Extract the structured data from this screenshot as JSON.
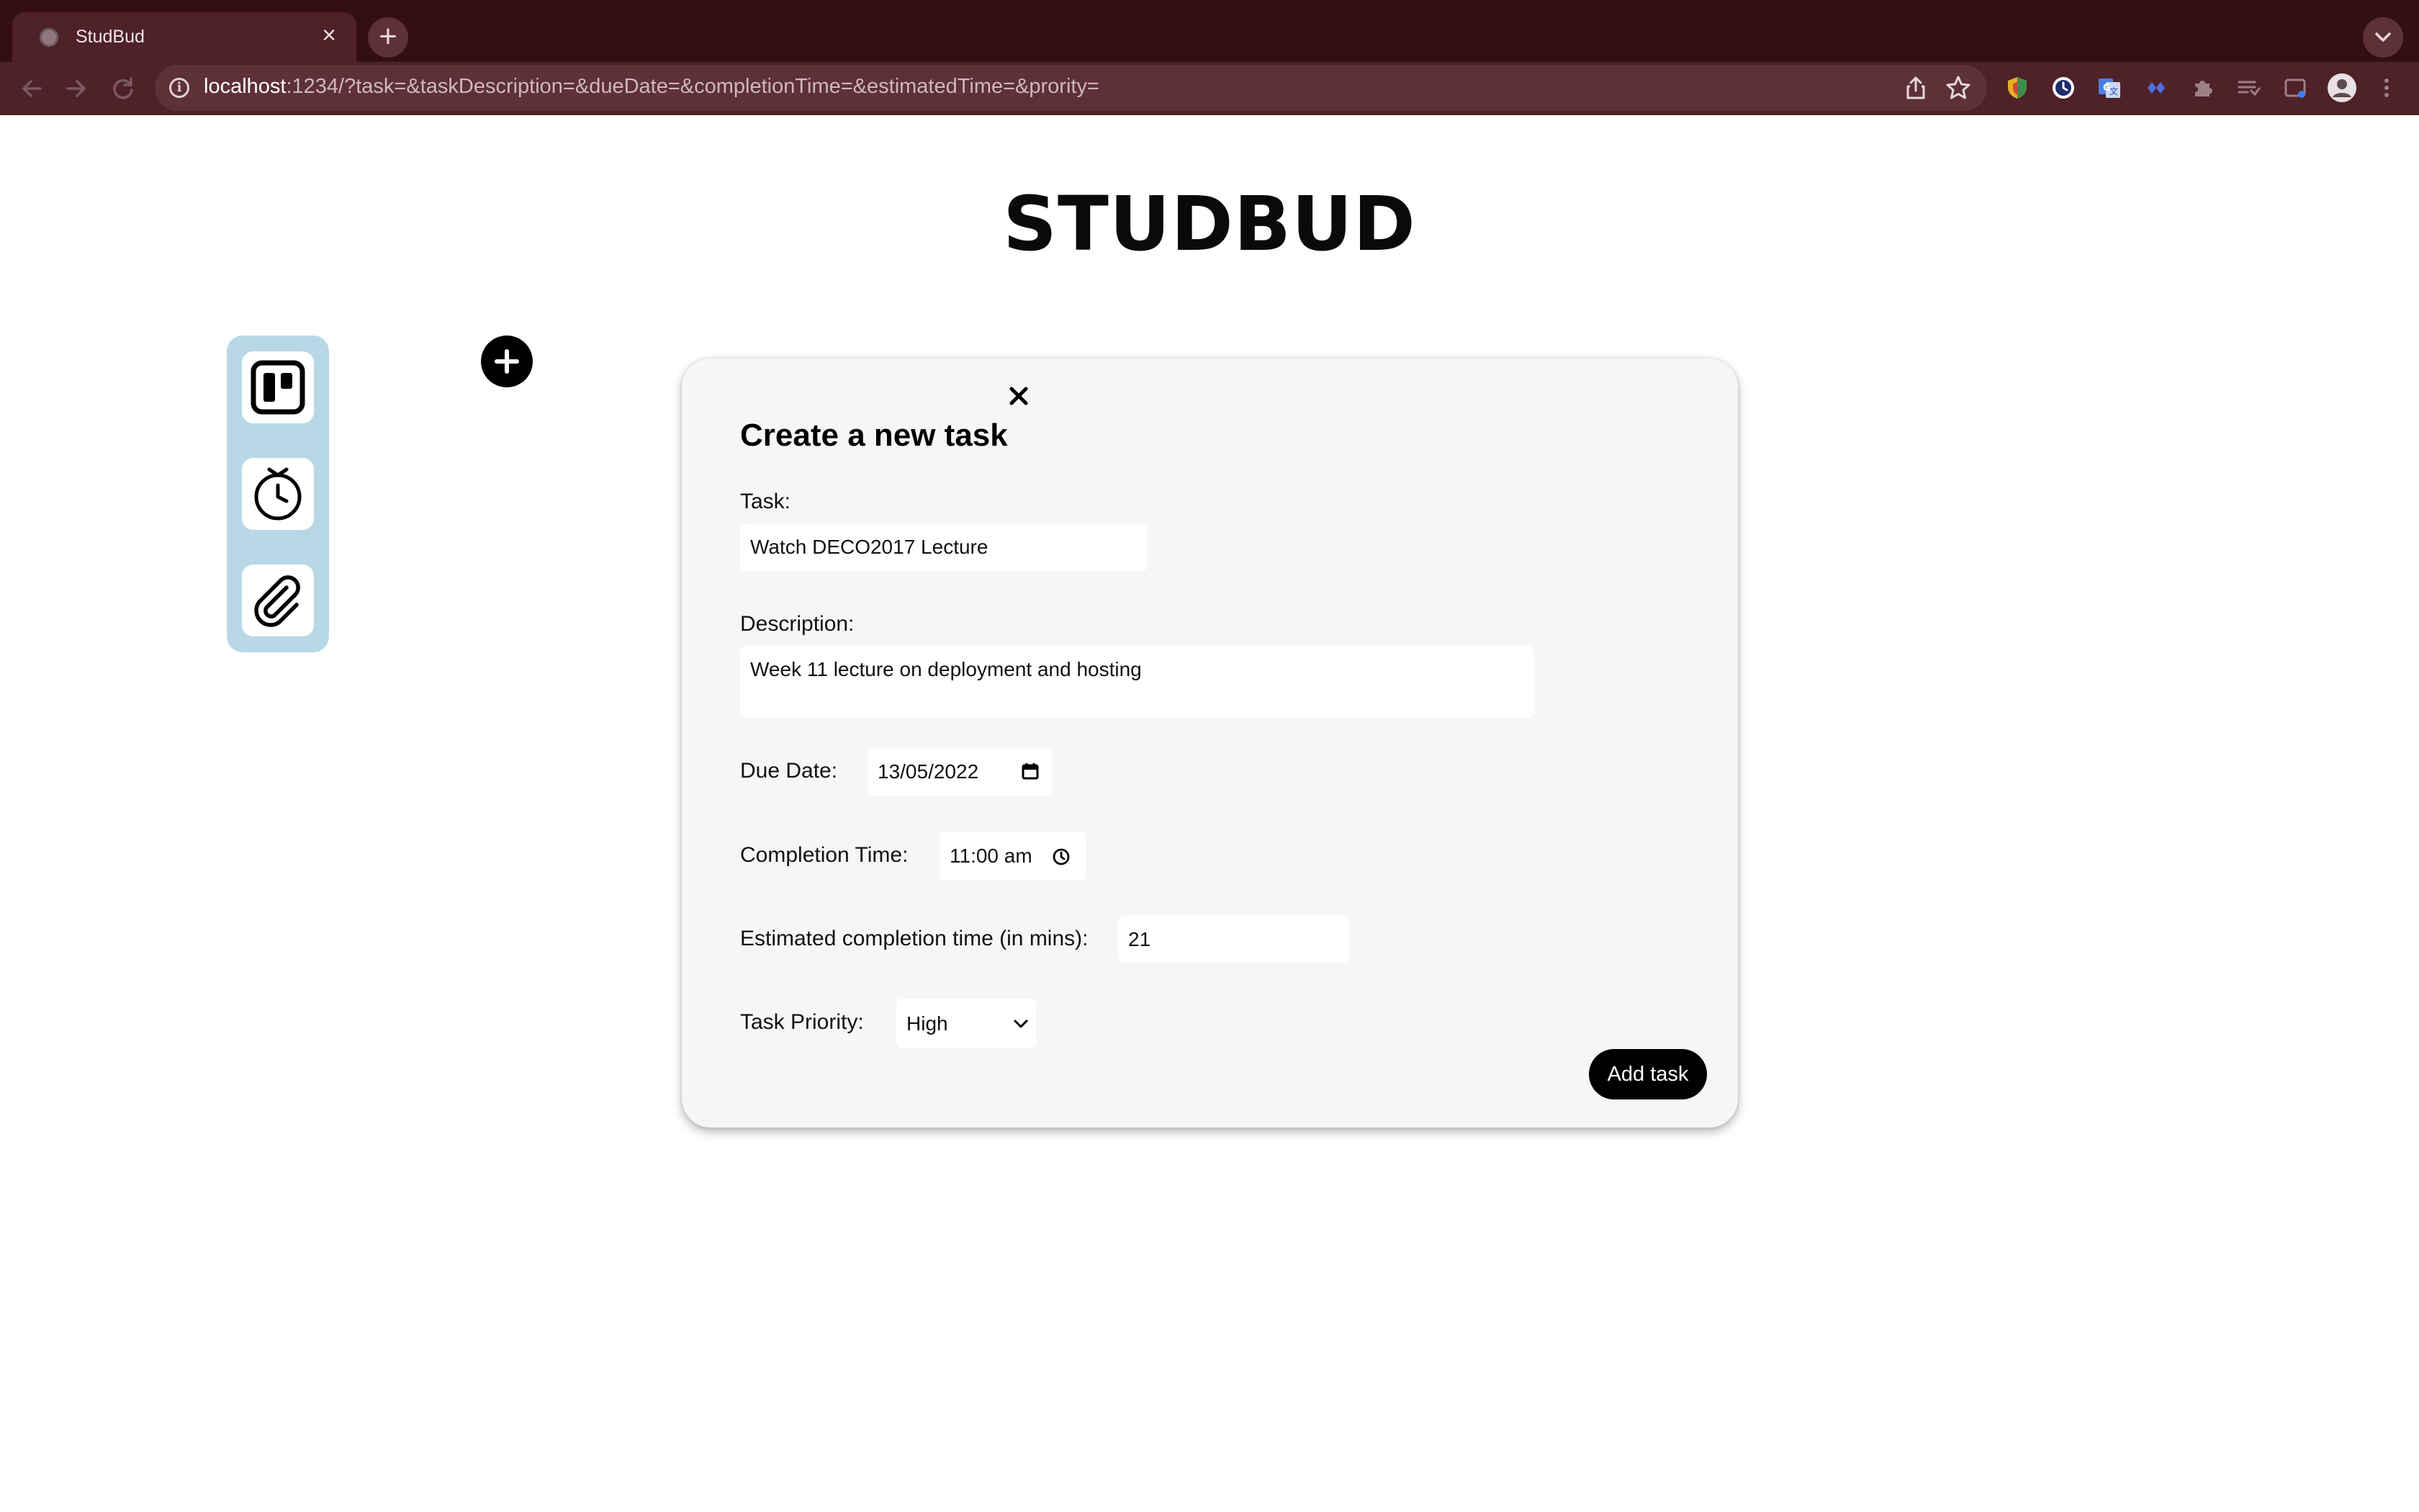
{
  "browser": {
    "tab_title": "StudBud",
    "url_host": "localhost",
    "url_rest": ":1234/?task=&taskDescription=&dueDate=&completionTime=&estimatedTime=&prority="
  },
  "page": {
    "title": "STUDBUD"
  },
  "sidebar": {
    "items": [
      {
        "icon": "board-icon"
      },
      {
        "icon": "stopwatch-icon"
      },
      {
        "icon": "paperclip-icon"
      }
    ]
  },
  "modal": {
    "heading": "Create a new task",
    "task_label": "Task:",
    "task_value": "Watch DECO2017 Lecture",
    "description_label": "Description:",
    "description_value": "Week 11 lecture on deployment and hosting",
    "due_date_label": "Due Date:",
    "due_date_value": "13/05/2022",
    "completion_time_label": "Completion Time:",
    "completion_time_value": "11:00 am",
    "estimated_label": "Estimated completion time (in mins):",
    "estimated_value": "21",
    "priority_label": "Task Priority:",
    "priority_value": "High",
    "submit_label": "Add task"
  },
  "colors": {
    "tabstrip": "#330f12",
    "toolbar": "#4f2129",
    "sidebar": "#b8d8e6",
    "modal_bg": "#f6f6f6"
  }
}
